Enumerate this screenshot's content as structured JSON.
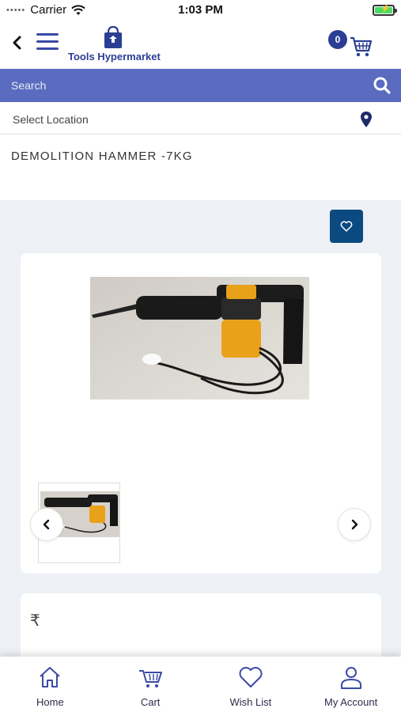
{
  "status_bar": {
    "carrier": "Carrier",
    "time": "1:03 PM",
    "signal": "•••••"
  },
  "header": {
    "logo_text": "Tools Hypermarket",
    "cart_count": "0"
  },
  "search": {
    "placeholder": "Search"
  },
  "location": {
    "label": "Select Location"
  },
  "product": {
    "title": "DEMOLITION HAMMER -7KG",
    "currency_symbol": "₹"
  },
  "bottom_nav": [
    {
      "label": "Home",
      "icon": "home-icon"
    },
    {
      "label": "Cart",
      "icon": "cart-icon"
    },
    {
      "label": "Wish List",
      "icon": "heart-icon"
    },
    {
      "label": "My Account",
      "icon": "user-icon"
    }
  ],
  "colors": {
    "brand": "#2c3e94",
    "search_bar": "#5a6bc0",
    "wishlist_button": "#0b4a80",
    "background": "#edf1f5"
  }
}
